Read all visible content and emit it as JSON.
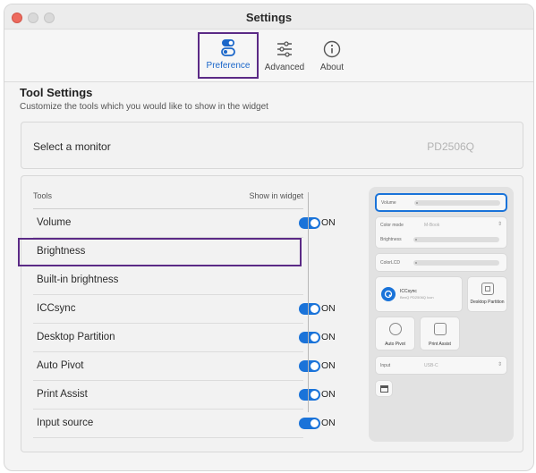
{
  "window": {
    "title": "Settings"
  },
  "tabs": [
    {
      "label": "Preference",
      "icon": "toggle-settings-icon",
      "active": true
    },
    {
      "label": "Advanced",
      "icon": "sliders-icon",
      "active": false
    },
    {
      "label": "About",
      "icon": "info-icon",
      "active": false
    }
  ],
  "section": {
    "title": "Tool Settings",
    "subtitle": "Customize the tools which you would like to show in the widget"
  },
  "monitor": {
    "label": "Select a monitor",
    "value": "PD2506Q"
  },
  "tools_header": {
    "left": "Tools",
    "right": "Show in widget"
  },
  "tools": [
    {
      "name": "Volume",
      "on": true,
      "toggle_label": "ON"
    },
    {
      "name": "Brightness",
      "on": false,
      "toggle_label": ""
    },
    {
      "name": "Built-in brightness",
      "on": false,
      "toggle_label": ""
    },
    {
      "name": "ICCsync",
      "on": true,
      "toggle_label": "ON"
    },
    {
      "name": "Desktop Partition",
      "on": true,
      "toggle_label": "ON"
    },
    {
      "name": "Auto Pivot",
      "on": true,
      "toggle_label": "ON"
    },
    {
      "name": "Print Assist",
      "on": true,
      "toggle_label": "ON"
    },
    {
      "name": "Input source",
      "on": true,
      "toggle_label": "ON"
    }
  ],
  "preview": {
    "volume_label": "Volume",
    "color_mode_label": "Color mode",
    "color_mode_value": "M-Book",
    "brightness_label": "Brightness",
    "colorlcd_label": "ColorLCD",
    "iccsync_title": "ICCsync",
    "iccsync_sub": "BenQ PD2506Q Icon",
    "desktop_partition_label": "Desktop Partition",
    "auto_pivot_label": "Auto Pivot",
    "print_assist_label": "Print Assist",
    "input_label": "Input",
    "input_value": "USB-C"
  },
  "colors": {
    "accent": "#1a73d9",
    "highlight": "#5b2a86",
    "close": "#ed6a5e"
  }
}
